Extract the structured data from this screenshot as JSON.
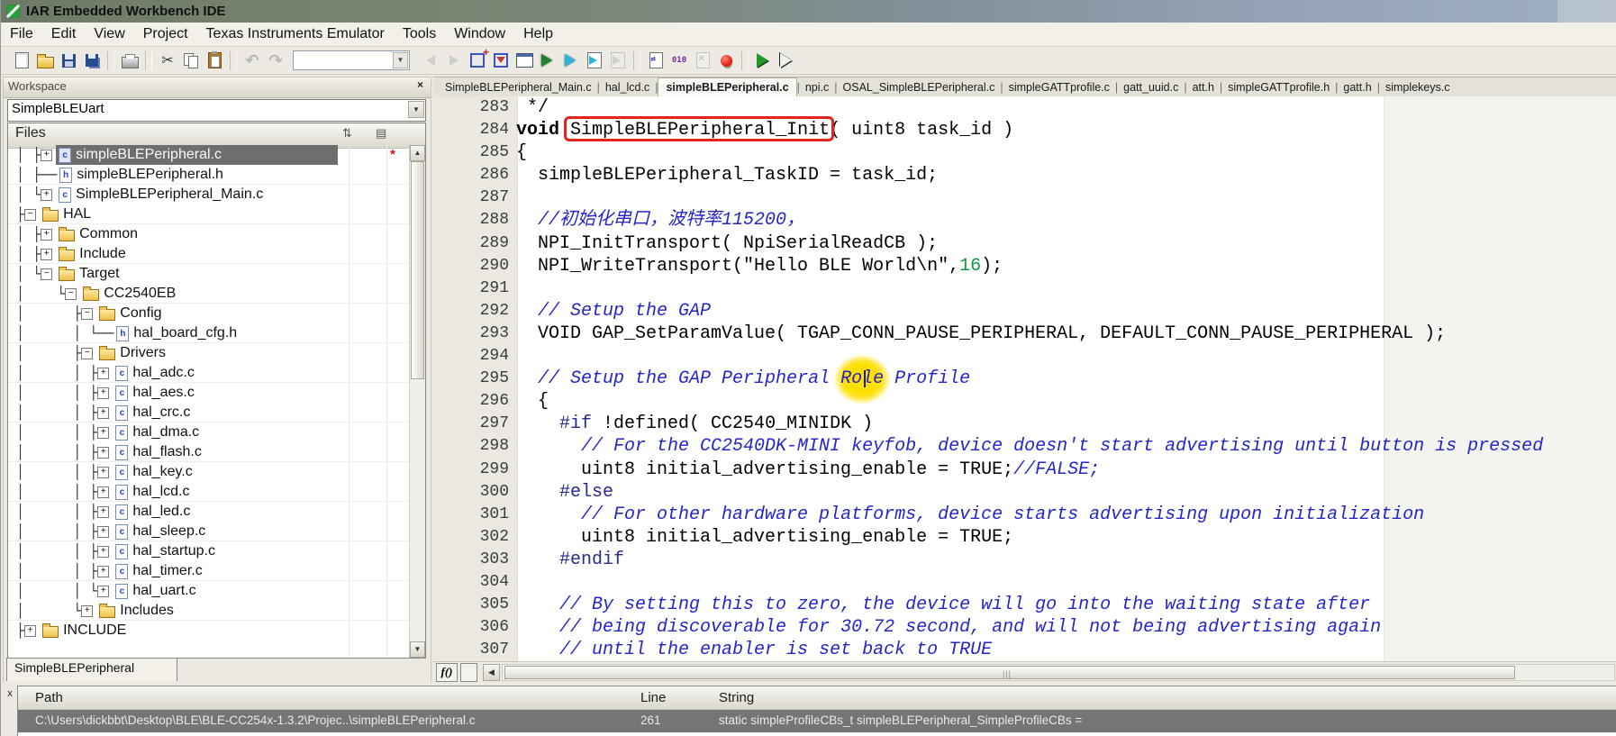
{
  "window": {
    "title": "IAR Embedded Workbench IDE"
  },
  "menu": {
    "items": [
      "File",
      "Edit",
      "View",
      "Project",
      "Texas Instruments Emulator",
      "Tools",
      "Window",
      "Help"
    ]
  },
  "toolbar": {
    "items": [
      {
        "name": "new-document",
        "type": "page"
      },
      {
        "name": "open-file",
        "type": "folder"
      },
      {
        "name": "save",
        "type": "floppy"
      },
      {
        "name": "save-all",
        "type": "floppy2"
      },
      {
        "name": "separator-1",
        "type": "separator"
      },
      {
        "name": "print",
        "type": "printer"
      },
      {
        "name": "separator-2",
        "type": "separator"
      },
      {
        "name": "cut",
        "type": "cut",
        "text": "✂"
      },
      {
        "name": "copy",
        "type": "copy"
      },
      {
        "name": "paste",
        "type": "paste"
      },
      {
        "name": "separator-3",
        "type": "separator"
      },
      {
        "name": "undo",
        "type": "undo",
        "text": "↶",
        "disabled": true
      },
      {
        "name": "redo",
        "type": "redo",
        "text": "↷",
        "disabled": true
      },
      {
        "name": "find-combo",
        "type": "combo"
      },
      {
        "name": "find-previous",
        "type": "arrow-prev",
        "disabled": true
      },
      {
        "name": "find-next",
        "type": "arrow-next",
        "disabled": true
      },
      {
        "name": "toggle-bookmark",
        "type": "bookmark-add"
      },
      {
        "name": "goto-bookmark",
        "type": "bookmark-next"
      },
      {
        "name": "options-dialog",
        "type": "window"
      },
      {
        "name": "compile",
        "type": "chip-green"
      },
      {
        "name": "make",
        "type": "arrow-cyan"
      },
      {
        "name": "build-all",
        "type": "arrow-cyan-page"
      },
      {
        "name": "stop-build",
        "type": "page-gray",
        "disabled": true
      },
      {
        "name": "separator-4",
        "type": "separator"
      },
      {
        "name": "source-browser",
        "type": "page-blue"
      },
      {
        "name": "debug-log",
        "type": "bits",
        "text": "010"
      },
      {
        "name": "remove-all-breakpoints",
        "type": "page-x",
        "disabled": true
      },
      {
        "name": "toggle-breakpoint",
        "type": "breakpoint"
      },
      {
        "name": "separator-5",
        "type": "separator"
      },
      {
        "name": "download-and-debug",
        "type": "play1"
      },
      {
        "name": "debug-without-downloading",
        "type": "play2"
      }
    ]
  },
  "workspace": {
    "title": "Workspace",
    "close_label": "×",
    "project_selector": "SimpleBLEUart",
    "files_header": "Files",
    "bottom_tab": "SimpleBLEPeripheral",
    "tree": [
      {
        "pre": " │ ├",
        "exp": "+",
        "icon": "c",
        "label": "simpleBLEPeripheral.c",
        "selected": true
      },
      {
        "pre": " │ ├──",
        "exp": "",
        "icon": "h",
        "label": "simpleBLEPeripheral.h"
      },
      {
        "pre": " │ └",
        "exp": "+",
        "icon": "c",
        "label": "SimpleBLEPeripheral_Main.c"
      },
      {
        "pre": " ├",
        "exp": "-",
        "icon": "folder",
        "label": "HAL"
      },
      {
        "pre": " │ ├",
        "exp": "+",
        "icon": "folder",
        "label": "Common"
      },
      {
        "pre": " │ ├",
        "exp": "+",
        "icon": "folder",
        "label": "Include"
      },
      {
        "pre": " │ └",
        "exp": "-",
        "icon": "folder",
        "label": "Target"
      },
      {
        "pre": " │    └",
        "exp": "-",
        "icon": "folder",
        "label": "CC2540EB"
      },
      {
        "pre": " │      ├",
        "exp": "-",
        "icon": "folder",
        "label": "Config"
      },
      {
        "pre": " │      │ └──",
        "exp": "",
        "icon": "h",
        "label": "hal_board_cfg.h"
      },
      {
        "pre": " │      ├",
        "exp": "-",
        "icon": "folder",
        "label": "Drivers"
      },
      {
        "pre": " │      │ ├",
        "exp": "+",
        "icon": "c",
        "label": "hal_adc.c"
      },
      {
        "pre": " │      │ ├",
        "exp": "+",
        "icon": "c",
        "label": "hal_aes.c"
      },
      {
        "pre": " │      │ ├",
        "exp": "+",
        "icon": "c",
        "label": "hal_crc.c"
      },
      {
        "pre": " │      │ ├",
        "exp": "+",
        "icon": "c",
        "label": "hal_dma.c"
      },
      {
        "pre": " │      │ ├",
        "exp": "+",
        "icon": "c",
        "label": "hal_flash.c"
      },
      {
        "pre": " │      │ ├",
        "exp": "+",
        "icon": "c",
        "label": "hal_key.c"
      },
      {
        "pre": " │      │ ├",
        "exp": "+",
        "icon": "c",
        "label": "hal_lcd.c"
      },
      {
        "pre": " │      │ ├",
        "exp": "+",
        "icon": "c",
        "label": "hal_led.c"
      },
      {
        "pre": " │      │ ├",
        "exp": "+",
        "icon": "c",
        "label": "hal_sleep.c"
      },
      {
        "pre": " │      │ ├",
        "exp": "+",
        "icon": "c",
        "label": "hal_startup.c"
      },
      {
        "pre": " │      │ ├",
        "exp": "+",
        "icon": "c",
        "label": "hal_timer.c"
      },
      {
        "pre": " │      │ └",
        "exp": "+",
        "icon": "c",
        "label": "hal_uart.c"
      },
      {
        "pre": " │      └",
        "exp": "+",
        "icon": "folder",
        "label": "Includes"
      },
      {
        "pre": " ├",
        "exp": "+",
        "icon": "folder",
        "label": "INCLUDE"
      }
    ]
  },
  "editor": {
    "fx_label": "f()",
    "tabs": [
      {
        "label": "SimpleBLEPeripheral_Main.c"
      },
      {
        "label": "hal_lcd.c"
      },
      {
        "label": "simpleBLEPeripheral.c",
        "active": true
      },
      {
        "label": "npi.c"
      },
      {
        "label": "OSAL_SimpleBLEPeripheral.c"
      },
      {
        "label": "simpleGATTprofile.c"
      },
      {
        "label": "gatt_uuid.c"
      },
      {
        "label": "att.h"
      },
      {
        "label": "simpleGATTprofile.h"
      },
      {
        "label": "gatt.h"
      },
      {
        "label": "simplekeys.c"
      }
    ],
    "code": {
      "lines": [
        {
          "n": 283,
          "s": [
            [
              "p",
              " */"
            ]
          ]
        },
        {
          "n": 284,
          "s": [
            [
              "k",
              "void"
            ],
            [
              "p",
              " "
            ],
            [
              "b",
              "SimpleBLEPeripheral_Init"
            ],
            [
              "p",
              "( uint8 task_id )"
            ]
          ]
        },
        {
          "n": 285,
          "s": [
            [
              "p",
              "{"
            ]
          ]
        },
        {
          "n": 286,
          "s": [
            [
              "p",
              "  simpleBLEPeripheral_TaskID = task_id;"
            ]
          ]
        },
        {
          "n": 287,
          "s": []
        },
        {
          "n": 288,
          "s": [
            [
              "p",
              "  "
            ],
            [
              "c",
              "//初始化串口，波特率115200，"
            ]
          ]
        },
        {
          "n": 289,
          "s": [
            [
              "p",
              "  NPI_InitTransport( NpiSerialReadCB );"
            ]
          ]
        },
        {
          "n": 290,
          "s": [
            [
              "p",
              "  NPI_WriteTransport(\"Hello BLE World\\n\","
            ],
            [
              "n2",
              "16"
            ],
            [
              "p",
              ");"
            ]
          ]
        },
        {
          "n": 291,
          "s": []
        },
        {
          "n": 292,
          "s": [
            [
              "p",
              "  "
            ],
            [
              "c",
              "// Setup the GAP"
            ]
          ]
        },
        {
          "n": 293,
          "s": [
            [
              "p",
              "  VOID GAP_SetParamValue( TGAP_CONN_PAUSE_PERIPHERAL, DEFAULT_CONN_PAUSE_PERIPHERAL );"
            ]
          ]
        },
        {
          "n": 294,
          "s": []
        },
        {
          "n": 295,
          "s": [
            [
              "p",
              "  "
            ],
            [
              "c",
              "// Setup the GAP Peripheral "
            ],
            [
              "h",
              "Role"
            ],
            [
              "c",
              " Profile"
            ]
          ]
        },
        {
          "n": 296,
          "s": [
            [
              "p",
              "  {"
            ]
          ]
        },
        {
          "n": 297,
          "s": [
            [
              "p",
              "    "
            ],
            [
              "d",
              "#if"
            ],
            [
              "p",
              " !defined( CC2540_MINIDK )"
            ]
          ]
        },
        {
          "n": 298,
          "s": [
            [
              "p",
              "      "
            ],
            [
              "c",
              "// For the CC2540DK-MINI keyfob, device doesn't start advertising until button is pressed"
            ]
          ]
        },
        {
          "n": 299,
          "s": [
            [
              "p",
              "      uint8 initial_advertising_enable = TRUE;"
            ],
            [
              "c",
              "//FALSE;"
            ]
          ]
        },
        {
          "n": 300,
          "s": [
            [
              "p",
              "    "
            ],
            [
              "d",
              "#else"
            ]
          ]
        },
        {
          "n": 301,
          "s": [
            [
              "p",
              "      "
            ],
            [
              "c",
              "// For other hardware platforms, device starts advertising upon initialization"
            ]
          ]
        },
        {
          "n": 302,
          "s": [
            [
              "p",
              "      uint8 initial_advertising_enable = TRUE;"
            ]
          ]
        },
        {
          "n": 303,
          "s": [
            [
              "p",
              "    "
            ],
            [
              "d",
              "#endif"
            ]
          ]
        },
        {
          "n": 304,
          "s": []
        },
        {
          "n": 305,
          "s": [
            [
              "p",
              "    "
            ],
            [
              "c",
              "// By setting this to zero, the device will go into the waiting state after"
            ]
          ]
        },
        {
          "n": 306,
          "s": [
            [
              "p",
              "    "
            ],
            [
              "c",
              "// being discoverable for 30.72 second, and will not being advertising again"
            ]
          ]
        },
        {
          "n": 307,
          "s": [
            [
              "p",
              "    "
            ],
            [
              "c",
              "// until the enabler is set back to TRUE"
            ]
          ]
        }
      ]
    }
  },
  "results": {
    "close_label": "x",
    "columns": [
      "Path",
      "Line",
      "String"
    ],
    "rows": [
      {
        "path": "C:\\Users\\dickbbt\\Desktop\\BLE\\BLE-CC254x-1.3.2\\Projec..\\simpleBLEPeripheral.c",
        "line": "261",
        "string": "static simpleProfileCBs_t simpleBLEPeripheral_SimpleProfileCBs ="
      }
    ]
  }
}
